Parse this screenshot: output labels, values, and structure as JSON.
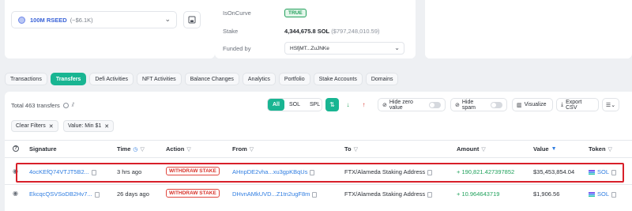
{
  "token_selector": {
    "name": "100M RSEED",
    "value": "(~$6.1K)"
  },
  "account_info": {
    "is_on_curve_label": "IsOnCurve",
    "is_on_curve_value": "TRUE",
    "stake_label": "Stake",
    "stake_value": "4,344,675.8 SOL",
    "stake_usd": "($797,248,010.59)",
    "funded_by_label": "Funded by",
    "funded_by_value": "HSfjMT...ZuJNKe"
  },
  "tabs": [
    "Transactions",
    "Transfers",
    "Defi Activities",
    "NFT Activities",
    "Balance Changes",
    "Analytics",
    "Portfolio",
    "Stake Accounts",
    "Domains"
  ],
  "active_tab": "Transfers",
  "toolbar": {
    "total_text": "Total 463 transfers",
    "filter_all": "All",
    "filter_sol": "SOL",
    "filter_spl": "SPL",
    "hide_zero_label": "Hide zero value",
    "hide_spam_label": "Hide spam",
    "visualize_label": "Visualize",
    "export_label": "Export CSV"
  },
  "filters": {
    "clear_label": "Clear Filters",
    "value_filter": "Value: Min $1"
  },
  "table": {
    "headers": [
      "Signature",
      "Time",
      "Action",
      "From",
      "To",
      "Amount",
      "Value",
      "Token"
    ],
    "rows": [
      {
        "signature": "4ocKEfQ74VTJT5B2...",
        "time": "3 hrs ago",
        "action": "WITHDRAW STAKE",
        "from": "AHnpDE2vha...xu3gpKBqUs",
        "to": "FTX/Alameda Staking Address",
        "amount": "+ 190,821.427397852",
        "value": "$35,453,854.04",
        "token": "SOL"
      },
      {
        "signature": "EkcqcQSVSoDB2Hv7...",
        "time": "26 days ago",
        "action": "WITHDRAW STAKE",
        "from": "DHvnAMkUVD...Z1tn2ugF8m",
        "to": "FTX/Alameda Staking Address",
        "amount": "+ 10.964643719",
        "value": "$1,906.56",
        "token": "SOL"
      }
    ]
  },
  "colors": {
    "accent": "#19b592",
    "link": "#2f7de1",
    "highlight": "#d8202a",
    "withdraw": "#d8342b",
    "positive": "#1fa15b"
  }
}
